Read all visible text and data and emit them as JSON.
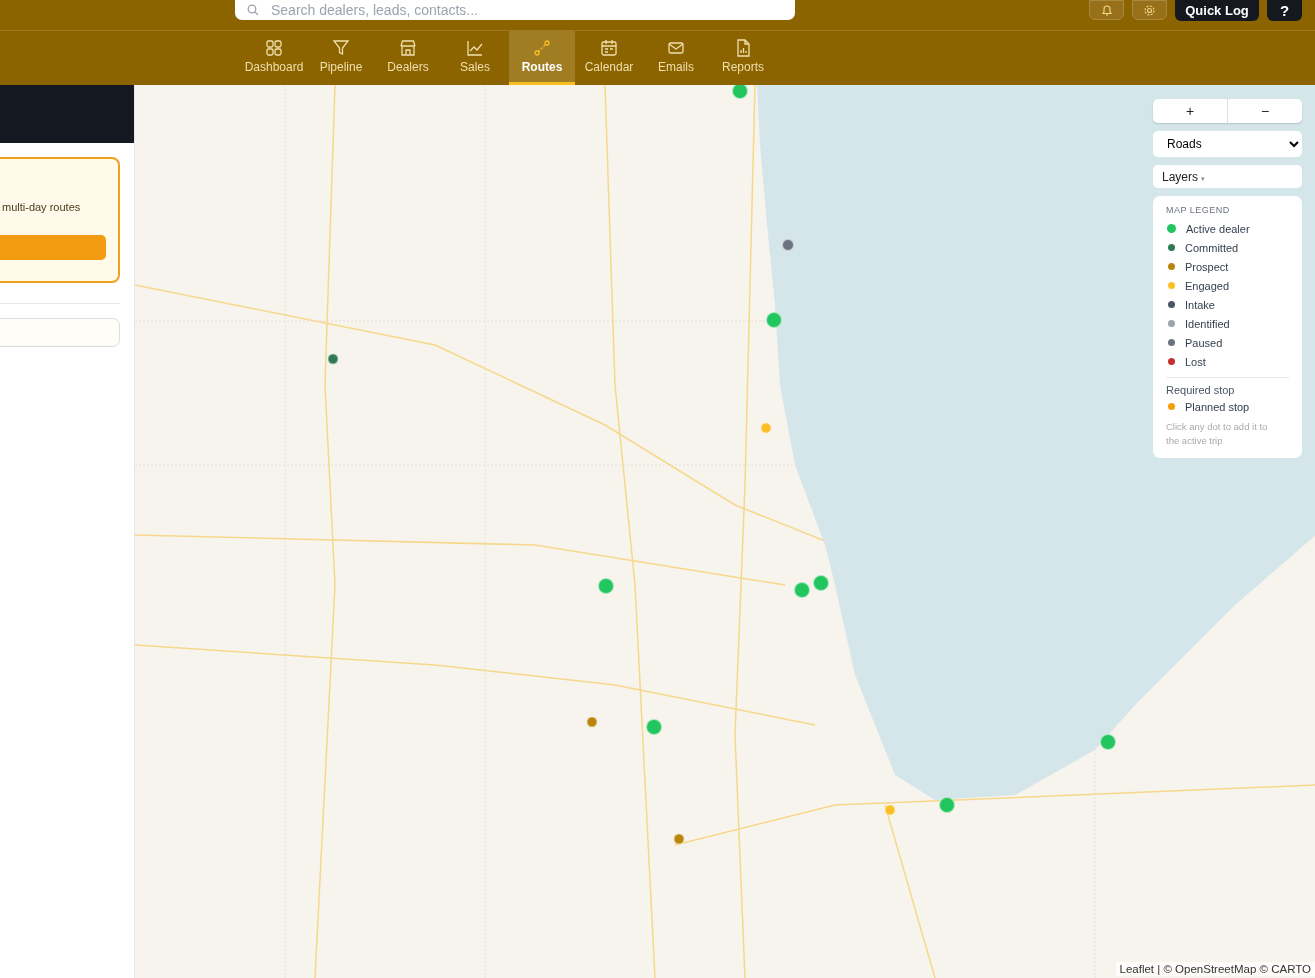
{
  "header": {
    "search": {
      "placeholder": "Search dealers, leads, contacts..."
    },
    "quick_log": "Quick Log",
    "help": "?"
  },
  "nav": [
    {
      "label": "Dashboard",
      "selected": false
    },
    {
      "label": "Pipeline",
      "selected": false
    },
    {
      "label": "Dealers",
      "selected": false
    },
    {
      "label": "Sales",
      "selected": false
    },
    {
      "label": "Routes",
      "selected": true
    },
    {
      "label": "Calendar",
      "selected": false
    },
    {
      "label": "Emails",
      "selected": false
    },
    {
      "label": "Reports",
      "selected": false
    }
  ],
  "sidebar": {
    "card_text": "multi-day routes"
  },
  "map": {
    "zoom_in": "+",
    "zoom_out": "−",
    "basemap": "Roads",
    "layers": "Layers",
    "layers_caret": "▾",
    "legend": {
      "title": "MAP LEGEND",
      "items": [
        {
          "label": "Active dealer",
          "color": "#22c55e",
          "kind": "large"
        },
        {
          "label": "Committed",
          "color": "#2f7a55",
          "kind": "small"
        },
        {
          "label": "Prospect",
          "color": "#b8860b",
          "kind": "small"
        },
        {
          "label": "Engaged",
          "color": "#fbbf24",
          "kind": "small"
        },
        {
          "label": "Intake",
          "color": "#4b5563",
          "kind": "small"
        },
        {
          "label": "Identified",
          "color": "#9ca3af",
          "kind": "small"
        },
        {
          "label": "Paused",
          "color": "#6b7280",
          "kind": "small"
        },
        {
          "label": "Lost",
          "color": "#c53030",
          "kind": "small"
        }
      ],
      "section": "Required stop",
      "planned": {
        "label": "Planned stop",
        "color": "#f59e0b"
      },
      "hint": "Click any dot to add it to the active trip"
    },
    "markers": [
      {
        "color": "#22c55e"
      },
      {
        "color": "#6b7280"
      },
      {
        "color": "#22c55e"
      },
      {
        "color": "#2f7a55"
      },
      {
        "color": "#fbbf24"
      },
      {
        "color": "#22c55e"
      },
      {
        "color": "#22c55e"
      },
      {
        "color": "#22c55e"
      },
      {
        "color": "#b8860b"
      },
      {
        "color": "#22c55e"
      },
      {
        "color": "#22c55e"
      },
      {
        "color": "#fbbf24"
      },
      {
        "color": "#22c55e"
      },
      {
        "color": "#b8860b"
      }
    ],
    "attribution": "Leaflet | © OpenStreetMap © CARTO"
  }
}
